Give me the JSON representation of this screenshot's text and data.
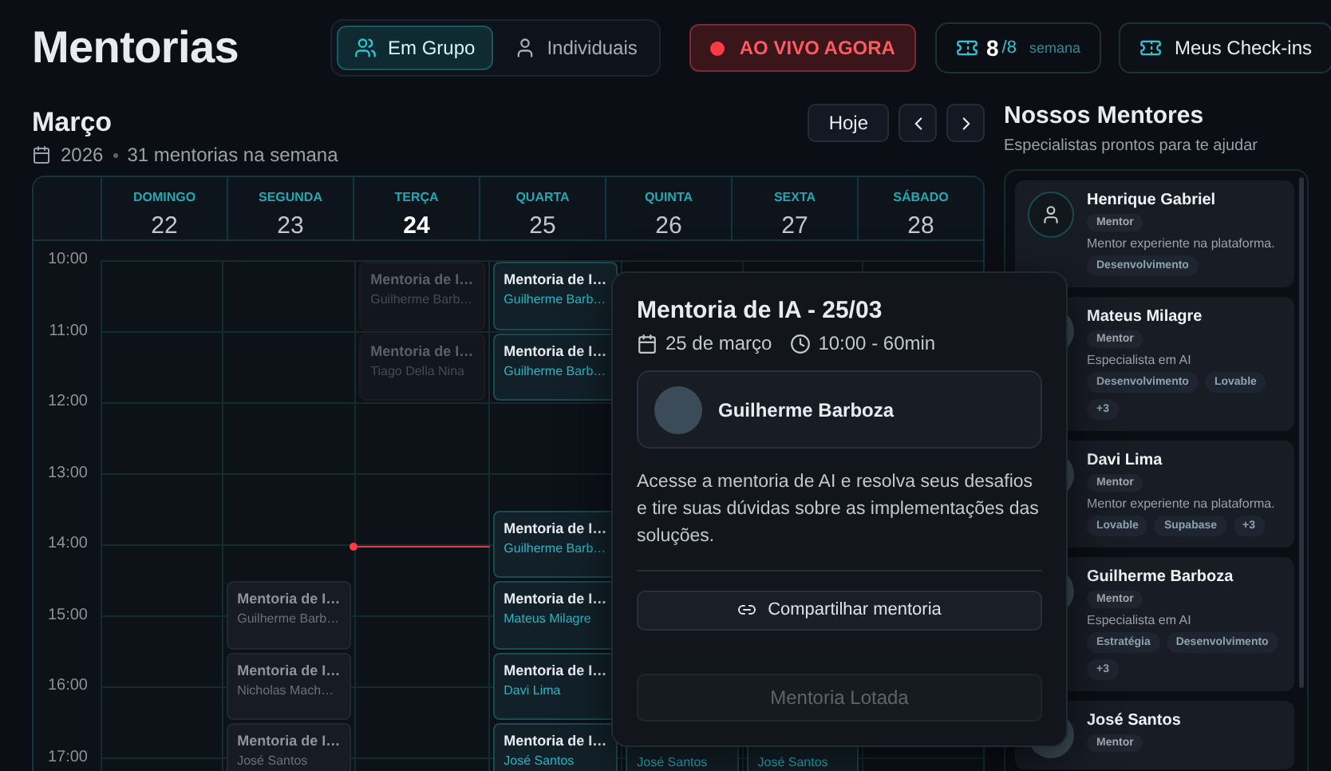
{
  "title": "Mentorias",
  "mode_tabs": [
    {
      "label": "Em Grupo",
      "selected": true
    },
    {
      "label": "Individuais",
      "selected": false
    }
  ],
  "live_button": {
    "label": "AO VIVO AGORA"
  },
  "checkins_counter": {
    "used": "8",
    "total": "/8",
    "unit": "semana"
  },
  "checkins_button": {
    "label": "Meus Check-ins"
  },
  "calendar": {
    "month": "Março",
    "year": "2026",
    "summary": "31 mentorias na semana",
    "today_button": "Hoje",
    "hours": [
      "10:00",
      "11:00",
      "12:00",
      "13:00",
      "14:00",
      "15:00",
      "16:00",
      "17:00"
    ],
    "days": [
      {
        "name": "DOMINGO",
        "date": "22",
        "today": false
      },
      {
        "name": "SEGUNDA",
        "date": "23",
        "today": false,
        "slots": [
          {
            "kind": "gap"
          },
          {
            "kind": "gap"
          },
          {
            "kind": "gap"
          },
          {
            "kind": "gap"
          },
          {
            "kind": "gap"
          },
          {
            "kind": "gap"
          },
          {
            "kind": "gap"
          },
          {
            "kind": "gap"
          },
          {
            "kind": "gap"
          },
          {
            "kind": "event",
            "past": false,
            "highlighted": false,
            "title": "Mentoria de I…",
            "mentor": "Guilherme Barb…"
          },
          {
            "kind": "event",
            "past": false,
            "highlighted": false,
            "title": "Mentoria de I…",
            "mentor": "Nicholas Mach…"
          },
          {
            "kind": "event",
            "past": false,
            "highlighted": false,
            "title": "Mentoria de I…",
            "mentor": "José Santos"
          }
        ]
      },
      {
        "name": "TERÇA",
        "date": "24",
        "today": true,
        "slots": [
          {
            "kind": "event",
            "past": true,
            "highlighted": false,
            "title": "Mentoria de I…",
            "mentor": "Guilherme Barb…"
          },
          {
            "kind": "event",
            "past": true,
            "highlighted": false,
            "title": "Mentoria de I…",
            "mentor": "Tiago Della Nina"
          },
          {
            "kind": "gap"
          },
          {
            "kind": "gap"
          },
          {
            "kind": "gap"
          },
          {
            "kind": "gap"
          },
          {
            "kind": "gap",
            "now": true
          }
        ]
      },
      {
        "name": "QUARTA",
        "date": "25",
        "today": false,
        "slots": [
          {
            "kind": "event",
            "past": false,
            "highlighted": true,
            "title": "Mentoria de I…",
            "mentor": "Guilherme Barb…"
          },
          {
            "kind": "event",
            "past": false,
            "highlighted": true,
            "title": "Mentoria de I…",
            "mentor": "Guilherme Barb…"
          },
          {
            "kind": "gap"
          },
          {
            "kind": "gap"
          },
          {
            "kind": "gap"
          },
          {
            "kind": "event",
            "past": false,
            "highlighted": true,
            "title": "Mentoria de I…",
            "mentor": "Guilherme Barb…"
          },
          {
            "kind": "event",
            "past": false,
            "highlighted": true,
            "title": "Mentoria de I…",
            "mentor": "Mateus Milagre"
          },
          {
            "kind": "event",
            "past": false,
            "highlighted": true,
            "title": "Mentoria de I…",
            "mentor": "Davi Lima"
          },
          {
            "kind": "event",
            "past": false,
            "highlighted": true,
            "title": "Mentoria de I…",
            "mentor": "José Santos"
          }
        ]
      },
      {
        "name": "QUINTA",
        "date": "26",
        "today": false,
        "slots": [
          {
            "kind": "gap"
          },
          {
            "kind": "gap"
          },
          {
            "kind": "gap"
          },
          {
            "kind": "gap"
          },
          {
            "kind": "gap"
          },
          {
            "kind": "gap"
          },
          {
            "kind": "gap"
          },
          {
            "kind": "gap"
          },
          {
            "kind": "gap"
          },
          {
            "kind": "gap"
          },
          {
            "kind": "gap"
          },
          {
            "kind": "gap"
          },
          {
            "kind": "gap"
          },
          {
            "kind": "event",
            "past": false,
            "highlighted": true,
            "mentor": "José Santos"
          }
        ]
      },
      {
        "name": "SEXTA",
        "date": "27",
        "today": false,
        "slots": [
          {
            "kind": "gap"
          },
          {
            "kind": "gap"
          },
          {
            "kind": "gap"
          },
          {
            "kind": "gap"
          },
          {
            "kind": "gap"
          },
          {
            "kind": "gap"
          },
          {
            "kind": "gap"
          },
          {
            "kind": "gap"
          },
          {
            "kind": "gap"
          },
          {
            "kind": "gap"
          },
          {
            "kind": "gap"
          },
          {
            "kind": "gap"
          },
          {
            "kind": "gap"
          },
          {
            "kind": "event",
            "past": false,
            "highlighted": true,
            "mentor": "José Santos"
          }
        ]
      },
      {
        "name": "SÁBADO",
        "date": "28",
        "today": false
      }
    ]
  },
  "popover": {
    "title": "Mentoria de IA - 25/03",
    "date": "25 de março",
    "time": "10:00 - 60min",
    "mentor": "Guilherme Barboza",
    "description": "Acesse a mentoria de AI e resolva seus desafios e tire suas dúvidas sobre as implementações das soluções.",
    "share_button": "Compartilhar mentoria",
    "status_button": {
      "label": "Mentoria Lotada",
      "disabled": true
    }
  },
  "mentors_panel": {
    "title": "Nossos Mentores",
    "subtitle": "Especialistas prontos para te ajudar",
    "mentors": [
      {
        "name": "Henrique Gabriel",
        "has_photo": false,
        "role": "Mentor",
        "bio": "Mentor experiente na plataforma.",
        "tags": [
          "Desenvolvimento"
        ]
      },
      {
        "name": "Mateus Milagre",
        "has_photo": true,
        "role": "Mentor",
        "bio": "Especialista em AI",
        "tags": [
          "Desenvolvimento",
          "Lovable",
          "+3"
        ]
      },
      {
        "name": "Davi Lima",
        "has_photo": true,
        "role": "Mentor",
        "bio": "Mentor experiente na plataforma.",
        "tags": [
          "Lovable",
          "Supabase",
          "+3"
        ]
      },
      {
        "name": "Guilherme Barboza",
        "has_photo": true,
        "role": "Mentor",
        "bio": "Especialista em AI",
        "tags": [
          "Estratégia",
          "Desenvolvimento",
          "+3"
        ]
      },
      {
        "name": "José Santos",
        "has_photo": true,
        "role": "Mentor"
      }
    ]
  }
}
